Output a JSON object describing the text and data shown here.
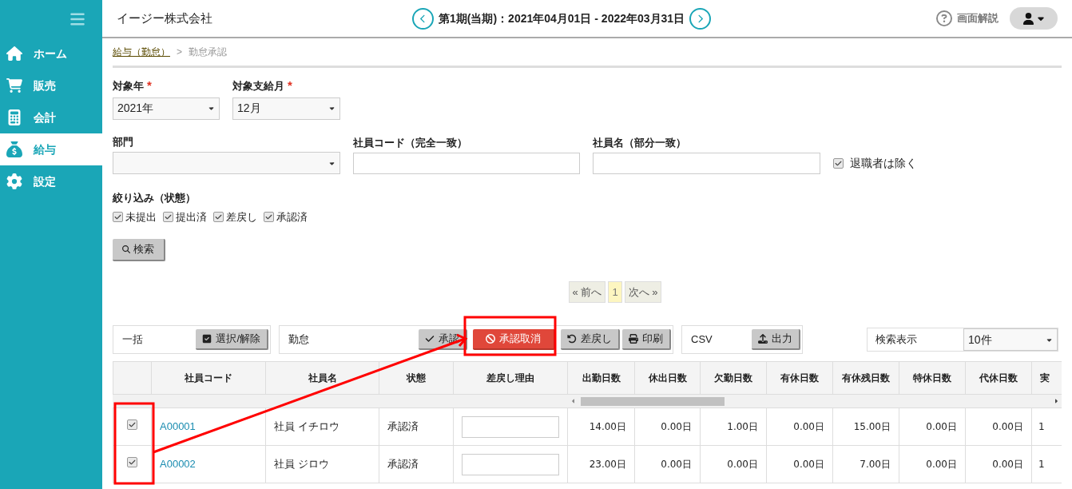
{
  "sidebar": {
    "items": [
      {
        "label": "ホーム",
        "selected": false
      },
      {
        "label": "販売",
        "selected": false
      },
      {
        "label": "会計",
        "selected": false
      },
      {
        "label": "給与",
        "selected": true
      },
      {
        "label": "設定",
        "selected": false
      }
    ]
  },
  "header": {
    "company": "イージー株式会社",
    "period": "第1期(当期)：2021年04月01日 - 2022年03月31日",
    "help": "画面解説"
  },
  "breadcrumb": {
    "items": [
      {
        "label": "給与（勤怠）",
        "link": true
      },
      {
        "label": "勤怠承認",
        "link": false
      }
    ],
    "separator": ">"
  },
  "filters": {
    "year": {
      "label": "対象年",
      "required_mark": "*",
      "value": "2021年"
    },
    "month": {
      "label": "対象支給月",
      "required_mark": "*",
      "value": "12月"
    },
    "department": {
      "label": "部門"
    },
    "employee_code": {
      "label": "社員コード（完全一致）"
    },
    "employee_name": {
      "label": "社員名（部分一致）"
    },
    "exclude_retired": {
      "label": "退職者は除く",
      "checked": true
    },
    "status": {
      "label": "絞り込み（状態）",
      "options": [
        {
          "label": "未提出",
          "checked": true
        },
        {
          "label": "提出済",
          "checked": true
        },
        {
          "label": "差戻し",
          "checked": true
        },
        {
          "label": "承認済",
          "checked": true
        }
      ]
    },
    "search_button": "検索"
  },
  "pagination": {
    "prev": "« 前へ",
    "pages": [
      {
        "label": "1",
        "selected": true
      }
    ],
    "next": "次へ »"
  },
  "toolbar": {
    "bulk": {
      "label": "一括",
      "buttons": [
        {
          "label": "選択/解除"
        }
      ]
    },
    "attendance": {
      "label": "勤怠",
      "buttons": [
        {
          "label": "承認",
          "kind": "normal"
        },
        {
          "label": "承認取消",
          "kind": "danger"
        },
        {
          "label": "差戻し",
          "kind": "normal"
        },
        {
          "label": "印刷",
          "kind": "normal"
        }
      ]
    },
    "csv": {
      "label": "CSV",
      "buttons": [
        {
          "label": "出力"
        }
      ]
    },
    "display": {
      "label": "検索表示",
      "value": "10件"
    }
  },
  "table": {
    "columns": [
      "社員コード",
      "社員名",
      "状態",
      "差戻し理由",
      "出勤日数",
      "休出日数",
      "欠勤日数",
      "有休日数",
      "有休残日数",
      "特休日数",
      "代休日数",
      "実"
    ],
    "rows": [
      {
        "checked": true,
        "cells": [
          "A00001",
          "社員 イチロウ",
          "承認済",
          "",
          "14.00日",
          "0.00日",
          "1.00日",
          "0.00日",
          "15.00日",
          "0.00日",
          "0.00日",
          "1"
        ]
      },
      {
        "checked": true,
        "cells": [
          "A00002",
          "社員 ジロウ",
          "承認済",
          "",
          "23.00日",
          "0.00日",
          "0.00日",
          "0.00日",
          "7.00日",
          "0.00日",
          "0.00日",
          "1"
        ]
      }
    ]
  }
}
